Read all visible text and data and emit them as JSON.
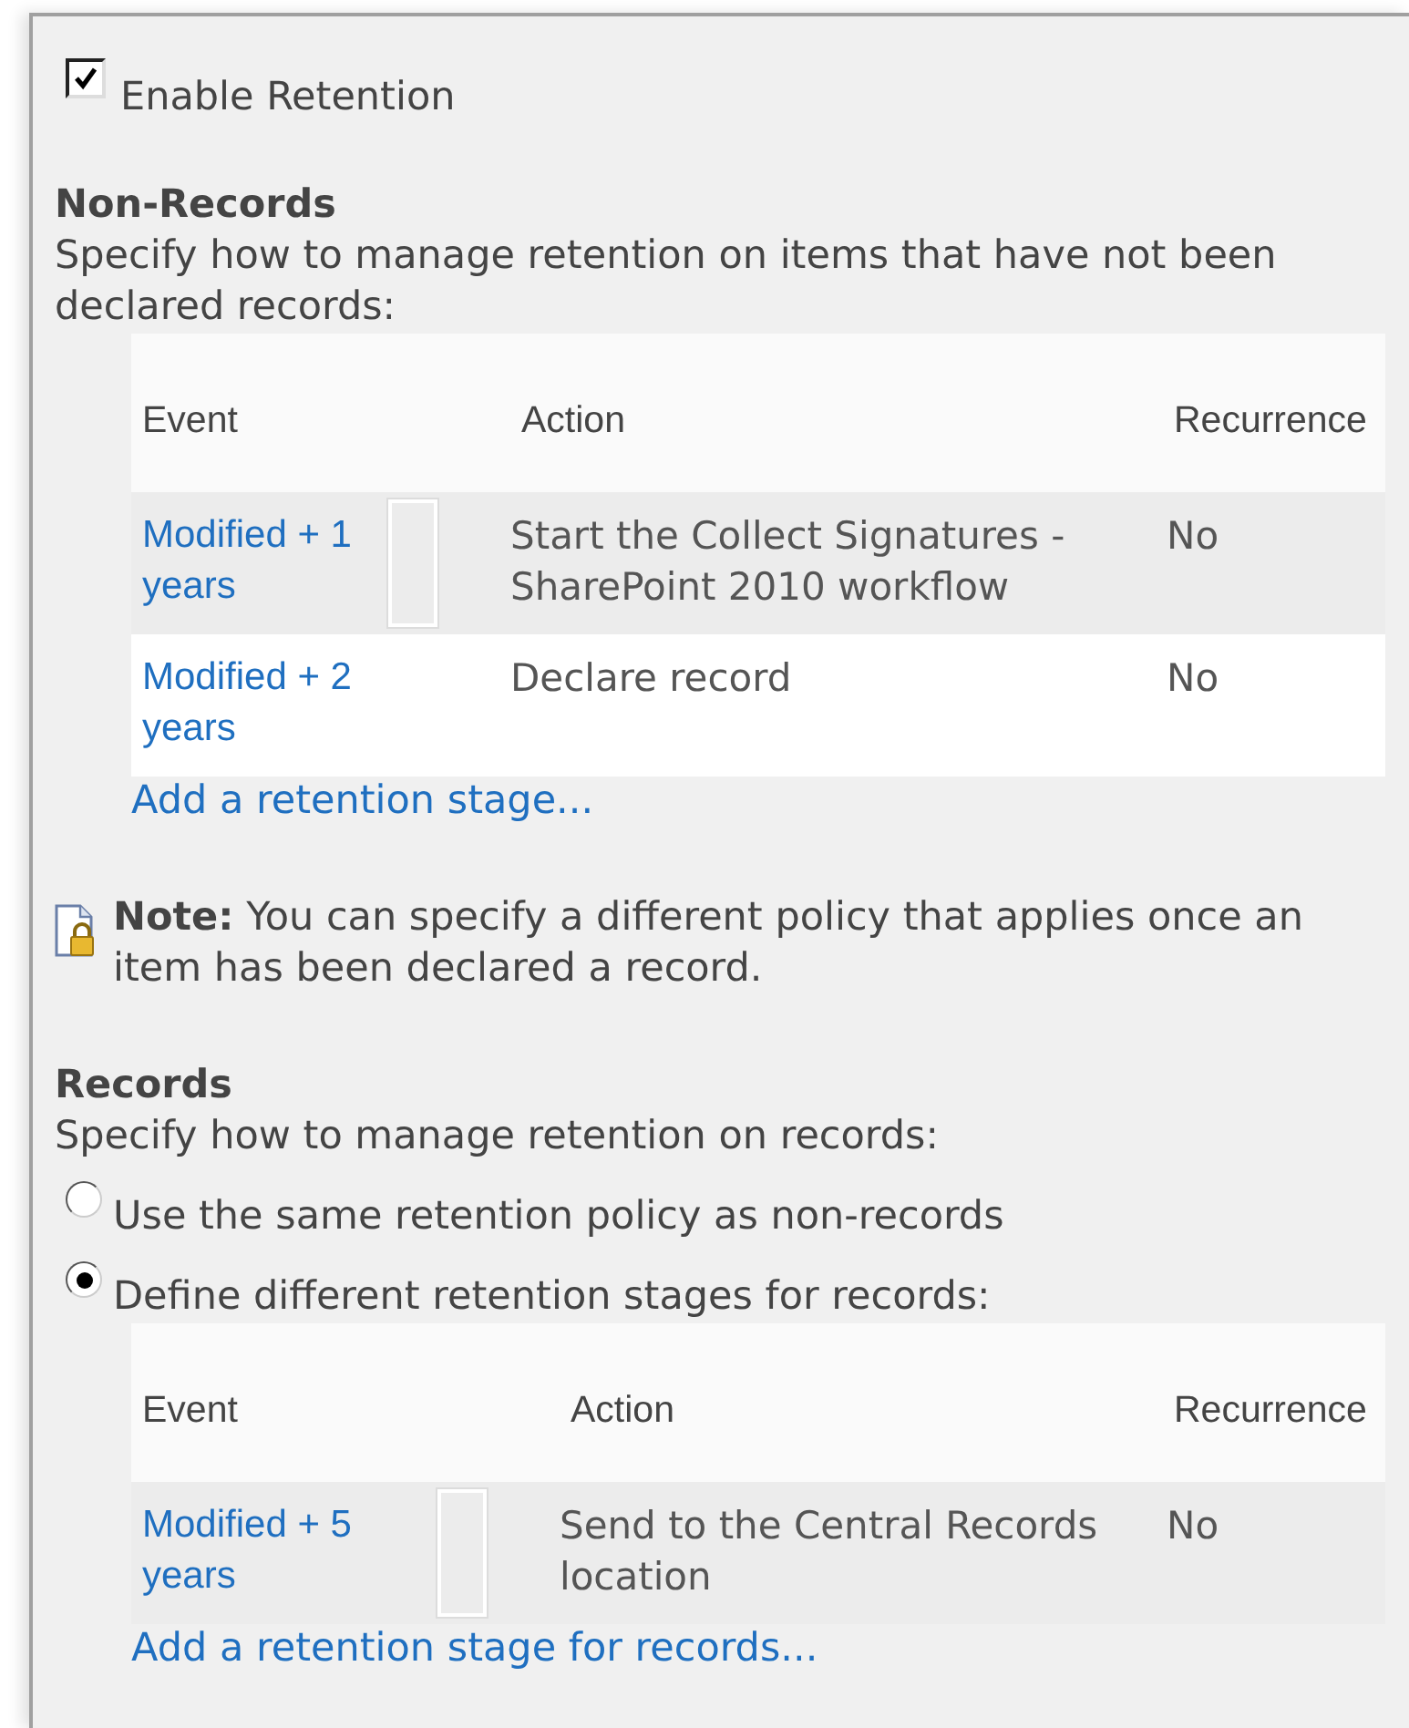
{
  "enable_retention": {
    "label": "Enable Retention",
    "checked": true
  },
  "non_records": {
    "heading": "Non-Records",
    "description": "Specify how to manage retention on items that have not been declared records:",
    "table": {
      "columns": [
        "Event",
        "Action",
        "Recurrence"
      ],
      "rows": [
        {
          "event": "Modified + 1 years",
          "action": "Start the Collect Signatures - SharePoint 2010 workflow",
          "recurrence": "No",
          "frame": true,
          "highlighted": false
        },
        {
          "event": "Modified + 2 years",
          "action": "Declare record",
          "recurrence": "No",
          "frame": false,
          "highlighted": true
        }
      ]
    },
    "add_link": "Add a retention stage..."
  },
  "note": "**Note:** You can specify a different policy that applies once an item has been declared a record.",
  "records": {
    "heading": "Records",
    "description": "Specify how to manage retention on records:",
    "options": [
      {
        "label": "Use the same retention policy as non-records",
        "selected": false
      },
      {
        "label": "Define different retention stages for records:",
        "selected": true
      }
    ],
    "table": {
      "columns": [
        "Event",
        "Action",
        "Recurrence"
      ],
      "rows": [
        {
          "event": "Modified + 5 years",
          "action": "Send to the Central Records location",
          "recurrence": "No",
          "frame": true,
          "highlighted": false
        }
      ]
    },
    "add_link": "Add a retention stage for records..."
  }
}
